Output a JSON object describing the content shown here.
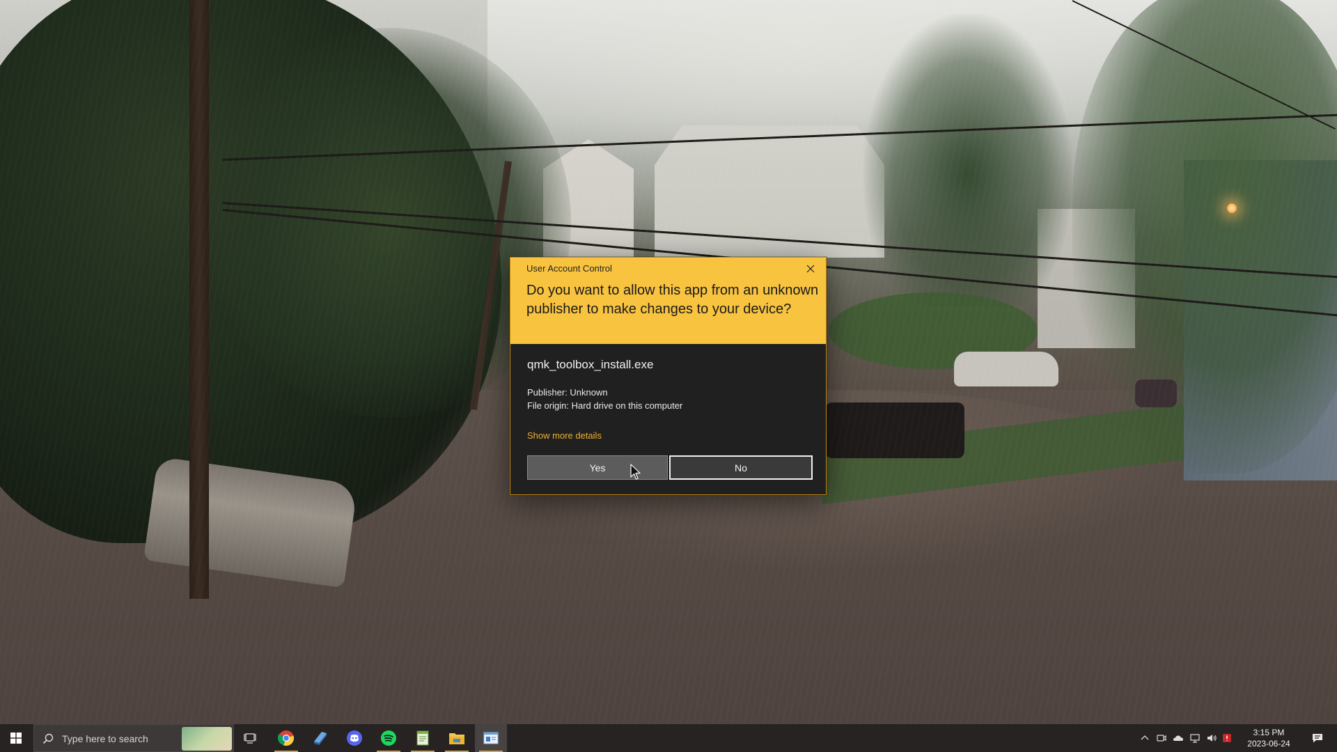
{
  "dialog": {
    "window_title": "User Account Control",
    "question": "Do you want to allow this app from an unknown publisher to make changes to your device?",
    "app_name": "qmk_toolbox_install.exe",
    "publisher": "Publisher: Unknown",
    "file_origin": "File origin: Hard drive on this computer",
    "details_link": "Show more details",
    "yes_label": "Yes",
    "no_label": "No",
    "header_color": "#f8c33f"
  },
  "taskbar": {
    "search_placeholder": "Type here to search",
    "pinned": [
      {
        "name": "task-view-icon"
      },
      {
        "name": "chrome-icon",
        "running": true
      },
      {
        "name": "app-icon"
      },
      {
        "name": "discord-icon"
      },
      {
        "name": "spotify-icon",
        "running": true
      },
      {
        "name": "notepad-icon",
        "running": true
      },
      {
        "name": "file-explorer-icon",
        "running": true
      },
      {
        "name": "installer-icon",
        "running": true,
        "selected": true
      }
    ],
    "tray": {
      "time": "3:15 PM",
      "date": "2023-06-24"
    },
    "accent": "#d7a23d"
  }
}
